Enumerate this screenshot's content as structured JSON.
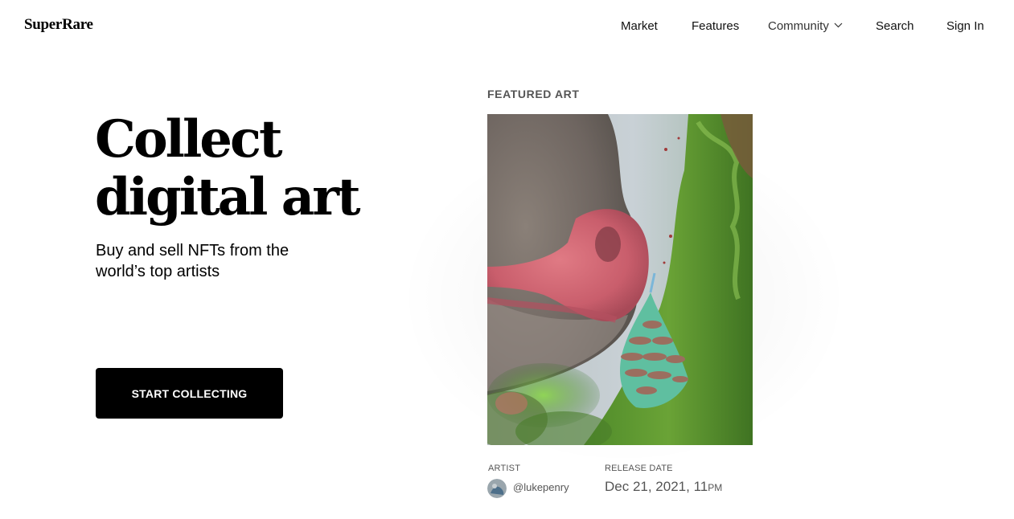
{
  "header": {
    "logo": "SuperRare",
    "nav": {
      "market": "Market",
      "features": "Features",
      "community": "Community",
      "search": "Search",
      "signin": "Sign In"
    }
  },
  "hero": {
    "title_line1": "Collect",
    "title_line2": "digital art",
    "subtitle": "Buy and sell NFTs from the world’s top artists",
    "cta": "START COLLECTING"
  },
  "featured": {
    "label": "FEATURED ART",
    "artist_label": "ARTIST",
    "artist_handle": "@lukepenry",
    "release_label": "RELEASE DATE",
    "release_date": "Dec 21, 2021, 11",
    "release_suffix": "PM"
  },
  "icons": {
    "community_dropdown": "chevron-down-icon"
  },
  "colors": {
    "cta_bg": "#000000",
    "cta_text": "#ffffff",
    "muted_text": "#555555"
  }
}
